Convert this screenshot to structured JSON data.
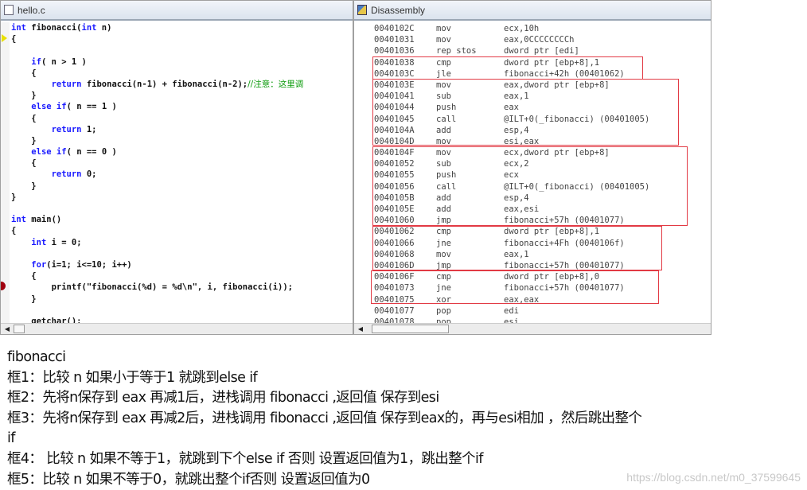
{
  "editor": {
    "title": "hello.c",
    "lines": [
      [
        [
          "int",
          "kw"
        ],
        [
          " fibonacci(",
          ""
        ],
        [
          "int",
          "kw"
        ],
        [
          " n)",
          ""
        ]
      ],
      [
        [
          "{",
          ""
        ]
      ],
      [],
      [
        [
          "    ",
          ""
        ],
        [
          "if",
          "kw"
        ],
        [
          "( n > 1 )",
          ""
        ]
      ],
      [
        [
          "    {",
          ""
        ]
      ],
      [
        [
          "        ",
          ""
        ],
        [
          "return",
          "kw"
        ],
        [
          " fibonacci(n-1) + fibonacci(n-2);",
          ""
        ],
        [
          "//注意：这里调",
          "cm"
        ]
      ],
      [
        [
          "    }",
          ""
        ]
      ],
      [
        [
          "    ",
          ""
        ],
        [
          "else if",
          "kw"
        ],
        [
          "( n == 1 )",
          ""
        ]
      ],
      [
        [
          "    {",
          ""
        ]
      ],
      [
        [
          "        ",
          ""
        ],
        [
          "return",
          "kw"
        ],
        [
          " 1;",
          ""
        ]
      ],
      [
        [
          "    }",
          ""
        ]
      ],
      [
        [
          "    ",
          ""
        ],
        [
          "else if",
          "kw"
        ],
        [
          "( n == 0 )",
          ""
        ]
      ],
      [
        [
          "    {",
          ""
        ]
      ],
      [
        [
          "        ",
          ""
        ],
        [
          "return",
          "kw"
        ],
        [
          " 0;",
          ""
        ]
      ],
      [
        [
          "    }",
          ""
        ]
      ],
      [
        [
          "}",
          ""
        ]
      ],
      [],
      [
        [
          "int",
          "kw"
        ],
        [
          " main()",
          ""
        ]
      ],
      [
        [
          "{",
          ""
        ]
      ],
      [
        [
          "    ",
          ""
        ],
        [
          "int",
          "kw"
        ],
        [
          " i = 0;",
          ""
        ]
      ],
      [],
      [
        [
          "    ",
          ""
        ],
        [
          "for",
          "kw"
        ],
        [
          "(i=1; i<=10; i++)",
          ""
        ]
      ],
      [
        [
          "    {",
          ""
        ]
      ],
      [
        [
          "        printf(\"fibonacci(%d) = %d\\n\", i, fibonacci(i));",
          ""
        ]
      ],
      [
        [
          "    }",
          ""
        ]
      ],
      [],
      [
        [
          "    getchar();",
          ""
        ]
      ]
    ]
  },
  "disassembly": {
    "title": "Disassembly",
    "rows": [
      [
        "0040102C",
        "mov",
        "ecx,10h"
      ],
      [
        "00401031",
        "mov",
        "eax,0CCCCCCCCh"
      ],
      [
        "00401036",
        "rep stos",
        "dword ptr [edi]"
      ],
      [
        "00401038",
        "cmp",
        "dword ptr [ebp+8],1"
      ],
      [
        "0040103C",
        "jle",
        "fibonacci+42h (00401062)"
      ],
      [
        "0040103E",
        "mov",
        "eax,dword ptr [ebp+8]"
      ],
      [
        "00401041",
        "sub",
        "eax,1"
      ],
      [
        "00401044",
        "push",
        "eax"
      ],
      [
        "00401045",
        "call",
        "@ILT+0(_fibonacci) (00401005)"
      ],
      [
        "0040104A",
        "add",
        "esp,4"
      ],
      [
        "0040104D",
        "mov",
        "esi,eax"
      ],
      [
        "0040104F",
        "mov",
        "ecx,dword ptr [ebp+8]"
      ],
      [
        "00401052",
        "sub",
        "ecx,2"
      ],
      [
        "00401055",
        "push",
        "ecx"
      ],
      [
        "00401056",
        "call",
        "@ILT+0(_fibonacci) (00401005)"
      ],
      [
        "0040105B",
        "add",
        "esp,4"
      ],
      [
        "0040105E",
        "add",
        "eax,esi"
      ],
      [
        "00401060",
        "jmp",
        "fibonacci+57h (00401077)"
      ],
      [
        "00401062",
        "cmp",
        "dword ptr [ebp+8],1"
      ],
      [
        "00401066",
        "jne",
        "fibonacci+4Fh (0040106f)"
      ],
      [
        "00401068",
        "mov",
        "eax,1"
      ],
      [
        "0040106D",
        "jmp",
        "fibonacci+57h (00401077)"
      ],
      [
        "0040106F",
        "cmp",
        "dword ptr [ebp+8],0"
      ],
      [
        "00401073",
        "jne",
        "fibonacci+57h (00401077)"
      ],
      [
        "00401075",
        "xor",
        "eax,eax"
      ],
      [
        "00401077",
        "pop",
        "edi"
      ],
      [
        "00401078",
        "pop",
        "esi"
      ]
    ],
    "highlight_color": "#e23a44"
  },
  "notes": [
    "fibonacci",
    "框1：比较 n 如果小于等于1 就跳到else if",
    "框2：先将n保存到 eax 再减1后，进栈调用 fibonacci ,返回值 保存到esi",
    "框3：先将n保存到 eax 再减2后，进栈调用 fibonacci ,返回值 保存到eax的，再与esi相加 ，然后跳出整个",
    "if",
    "框4： 比较 n 如果不等于1，就跳到下个else if 否则 设置返回值为1，跳出整个if",
    "框5：比较 n 如果不等于0，就跳出整个if否则 设置返回值为0"
  ],
  "watermark": "https://blog.csdn.net/m0_37599645"
}
